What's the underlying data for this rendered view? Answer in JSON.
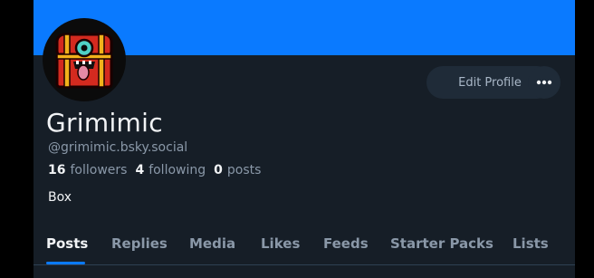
{
  "profile": {
    "display_name": "Grimimic",
    "handle": "@grimimic.bsky.social",
    "bio": "Box",
    "avatar_icon": "treasure-chest-mimic-avatar",
    "banner_color": "#0a7aff"
  },
  "stats": {
    "followers_count": "16",
    "followers_label": "followers",
    "following_count": "4",
    "following_label": "following",
    "posts_count": "0",
    "posts_label": "posts"
  },
  "actions": {
    "edit_profile_label": "Edit Profile",
    "more_icon": "ellipsis-icon"
  },
  "tabs": [
    {
      "label": "Posts",
      "active": true
    },
    {
      "label": "Replies",
      "active": false
    },
    {
      "label": "Media",
      "active": false
    },
    {
      "label": "Likes",
      "active": false
    },
    {
      "label": "Feeds",
      "active": false
    },
    {
      "label": "Starter Packs",
      "active": false
    },
    {
      "label": "Lists",
      "active": false
    }
  ],
  "colors": {
    "accent": "#0a7aff",
    "background": "#161e27",
    "text_primary": "#f1f3f5",
    "text_secondary": "#8a98a8"
  }
}
